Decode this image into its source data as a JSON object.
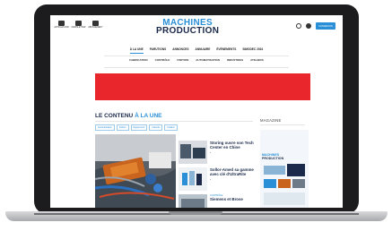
{
  "topbar": {
    "icons": [
      {
        "name": "article-icon",
        "label": "ARTICLES PAR"
      },
      {
        "name": "mail-icon",
        "label": "NEWSLETTER"
      },
      {
        "name": "subscribe-icon",
        "label": "ABONNEMENT"
      }
    ],
    "logo_line1": "MACHINES",
    "logo_line2": "PRODUCTION",
    "cta_label": "CONNEXION"
  },
  "nav_primary": [
    "À LA UNE",
    "PARUTIONS",
    "ANNONCES",
    "ANNUAIRE",
    "ÉVÉNEMENTS",
    "SIMODEC 2024"
  ],
  "nav_secondary": [
    "FABRICATION",
    "CONTRÔLE",
    "FINITION",
    "AUTOMATISATION",
    "INDUSTRIES",
    "ATELIERS"
  ],
  "content": {
    "heading_part1": "LE CONTENU",
    "heading_part2": "À LA UNE",
    "tags": [
      "Automatisation",
      "Finition",
      "Équipement",
      "Industrie",
      "Fixation"
    ],
    "articles": [
      {
        "title": "Storing ouvre son Tech Center en Chine",
        "meta": "●"
      },
      {
        "title": "Sollor-Amed sa gamme avec clé d'UltraRite",
        "meta": "●"
      },
      {
        "category": "CONTRÔLE",
        "title": "Siemens et Brose",
        "meta": ""
      }
    ]
  },
  "sidebar": {
    "title": "MAGAZINE",
    "mag_logo_line1": "MACHINES",
    "mag_logo_line2": "PRODUCTION"
  },
  "colors": {
    "brand_blue": "#2a8fd6",
    "navy": "#1b2a4a",
    "banner_red": "#e8262b",
    "laptop_frame": "#1c1c1e"
  }
}
